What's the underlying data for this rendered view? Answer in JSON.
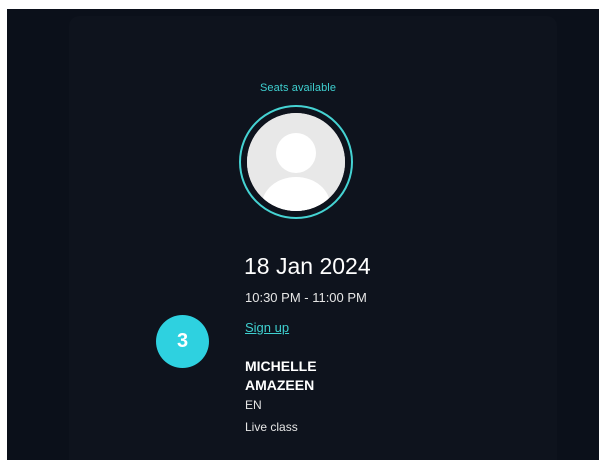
{
  "event": {
    "seats_label": "Seats available",
    "date": "18 Jan 2024",
    "time": "10:30 PM - 11:00 PM",
    "signup_label": "Sign up",
    "step_badge": "3",
    "instructor_name": "MICHELLE AMAZEEN",
    "language": "EN",
    "class_type": "Live class"
  },
  "icons": {
    "avatar": "user-placeholder-icon"
  },
  "colors": {
    "background": "#0b101a",
    "card": "#0e131d",
    "accent": "#3fd0d0",
    "badge": "#2ed1e0",
    "text": "#ffffff"
  }
}
